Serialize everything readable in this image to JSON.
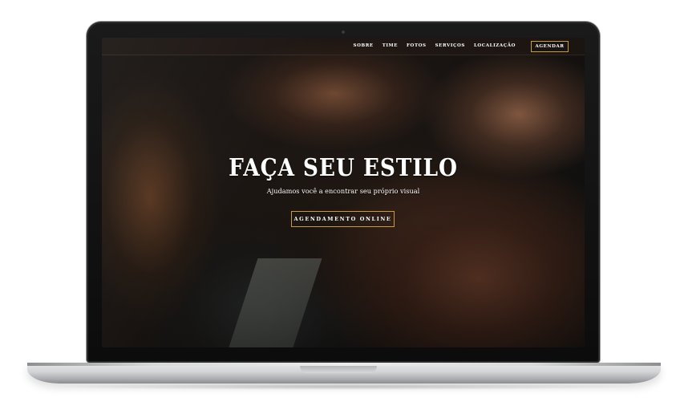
{
  "nav": {
    "links": [
      "SOBRE",
      "TIME",
      "FOTOS",
      "SERVIÇOS",
      "LOCALIZAÇÃO"
    ],
    "cta": "AGENDAR"
  },
  "hero": {
    "title": "FAÇA SEU ESTILO",
    "subtitle": "Ajudamos você a encontrar seu próprio visual",
    "cta": "AGENDAMENTO ONLINE"
  },
  "colors": {
    "accent": "#c99a3c",
    "text": "#ffffff"
  }
}
